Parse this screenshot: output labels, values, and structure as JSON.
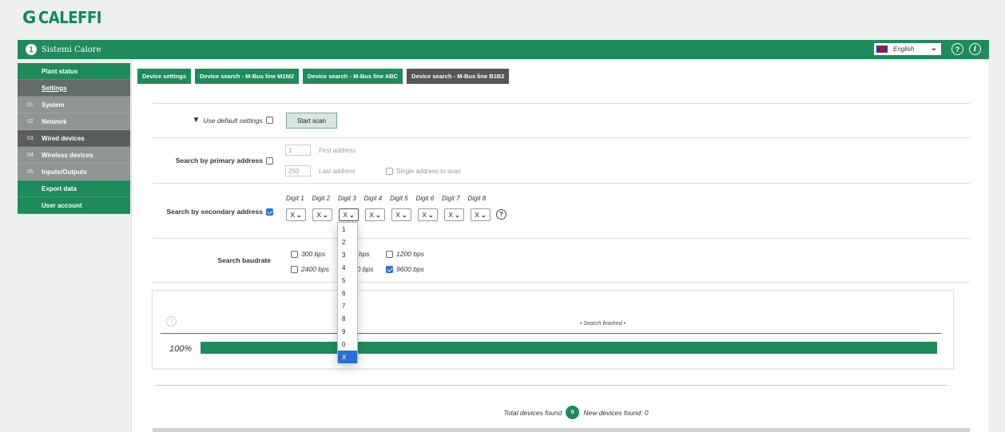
{
  "brand": {
    "mark": "G",
    "name": "CALEFFI"
  },
  "topbar": {
    "site_name": "Sistemi Calore",
    "language": "English",
    "help_glyph": "?",
    "info_glyph": "i"
  },
  "sidebar": {
    "items": [
      {
        "num": "",
        "label": "Plant status"
      },
      {
        "num": "",
        "label": "Settings"
      },
      {
        "num": "01",
        "label": "System"
      },
      {
        "num": "02",
        "label": "Network"
      },
      {
        "num": "03",
        "label": "Wired devices"
      },
      {
        "num": "04",
        "label": "Wireless devices"
      },
      {
        "num": "05",
        "label": "Inputs/Outputs"
      },
      {
        "num": "",
        "label": "Export data"
      },
      {
        "num": "",
        "label": "User account"
      }
    ]
  },
  "tabs": [
    "Device settings",
    "Device search - M-Bus line M1M2",
    "Device search - M-Bus line ABC",
    "Device search - M-Bus line B1B2"
  ],
  "default_settings": {
    "label": "Use default settings",
    "arrow": "▼",
    "checked": false
  },
  "start_scan": "Start scan",
  "primary": {
    "label": "Search by primary address",
    "first_value": "1",
    "first_hint": "First address",
    "last_value": "250",
    "last_hint": "Last address",
    "single_label": "Single address to scan"
  },
  "secondary": {
    "label": "Search by secondary address",
    "checked": true,
    "digit_headers": [
      "Digit 1",
      "Digit 2",
      "Digit 3",
      "Digit 4",
      "Digit 5",
      "Digit 6",
      "Digit 7",
      "Digit 8"
    ],
    "digit_values": [
      "X",
      "X",
      "X",
      "X",
      "X",
      "X",
      "X",
      "X"
    ],
    "help_glyph": "?"
  },
  "baudrate": {
    "label": "Search baudrate",
    "row1": [
      {
        "text": "300 bps",
        "checked": false
      },
      {
        "text": "0 bps",
        "checked": false
      },
      {
        "text": "1200 bps",
        "checked": false
      }
    ],
    "row2": [
      {
        "text": "2400 bps",
        "checked": false
      },
      {
        "text": "00 bps",
        "checked": false
      },
      {
        "text": "9600 bps",
        "checked": true
      }
    ]
  },
  "progress": {
    "status": "• Search finished •",
    "percent_label": "100%",
    "fraction": 1.0,
    "help_glyph": "?"
  },
  "totals": {
    "found_label": "Total devices found",
    "found_count": "0",
    "new_label": "New devices found: 0"
  },
  "dropdown": {
    "options": [
      "1",
      "2",
      "3",
      "4",
      "5",
      "6",
      "7",
      "8",
      "9",
      "0",
      "X"
    ],
    "selected": "X"
  },
  "colors": {
    "accent": "#1f8a5b",
    "sidebar_grey": "#8f9591",
    "sidebar_dark": "#5b5e5c",
    "select_blue": "#2a6fd3"
  }
}
